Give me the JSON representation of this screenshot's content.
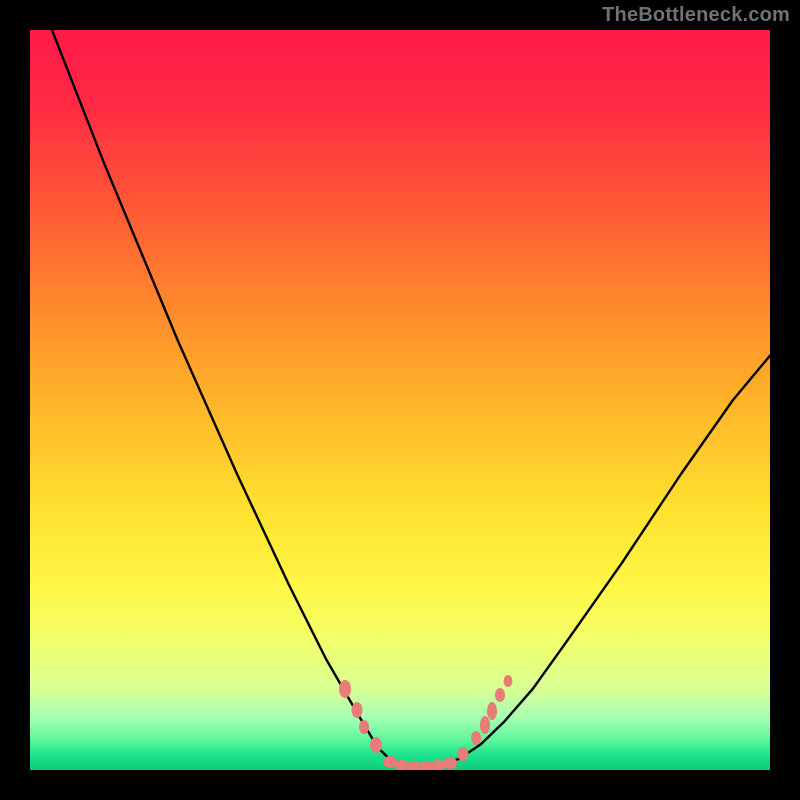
{
  "watermark": "TheBottleneck.com",
  "chart_data": {
    "type": "line",
    "title": "",
    "xlabel": "",
    "ylabel": "",
    "xlim": [
      0,
      100
    ],
    "ylim": [
      0,
      100
    ],
    "grid": false,
    "legend": false,
    "background_gradient_top_to_bottom": [
      "#ff1a47",
      "#ffe22f",
      "#0ccd7d"
    ],
    "series": [
      {
        "name": "bottleneck-curve",
        "color": "#000000",
        "x": [
          3,
          10,
          20,
          28,
          35,
          40,
          44,
          47,
          49,
          51,
          53,
          55,
          58,
          61,
          64,
          68,
          73,
          80,
          88,
          95,
          100
        ],
        "y": [
          100,
          82,
          58,
          40,
          25,
          15,
          8,
          3,
          1,
          0,
          0.2,
          0.6,
          1.5,
          3.5,
          6.5,
          11,
          18,
          28,
          40,
          50,
          56
        ]
      },
      {
        "name": "marker-dots",
        "color": "#e77d76",
        "type": "scatter",
        "x": [
          42.5,
          45,
          47,
          49,
          51,
          53,
          55,
          57,
          60,
          63
        ],
        "y": [
          11,
          6,
          2.5,
          0.8,
          0.3,
          0.5,
          1.2,
          3,
          7,
          12
        ]
      }
    ],
    "annotations": []
  }
}
